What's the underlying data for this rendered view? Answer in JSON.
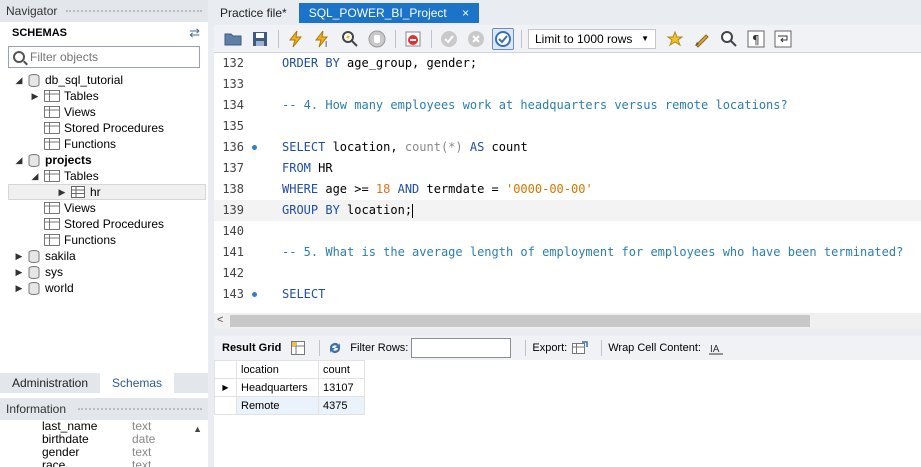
{
  "navigator": {
    "title": "Navigator",
    "schemas_label": "SCHEMAS",
    "filter_placeholder": "Filter objects",
    "tree": [
      {
        "label": "db_sql_tutorial",
        "kind": "schema",
        "expanded": true,
        "bold": false
      },
      {
        "label": "Tables",
        "kind": "folder",
        "expanded": false
      },
      {
        "label": "Views",
        "kind": "folder"
      },
      {
        "label": "Stored Procedures",
        "kind": "folder"
      },
      {
        "label": "Functions",
        "kind": "folder"
      },
      {
        "label": "projects",
        "kind": "schema",
        "expanded": true,
        "bold": true
      },
      {
        "label": "Tables",
        "kind": "folder",
        "expanded": true
      },
      {
        "label": "hr",
        "kind": "table",
        "selected": true
      },
      {
        "label": "Views",
        "kind": "folder"
      },
      {
        "label": "Stored Procedures",
        "kind": "folder"
      },
      {
        "label": "Functions",
        "kind": "folder"
      },
      {
        "label": "sakila",
        "kind": "schema"
      },
      {
        "label": "sys",
        "kind": "schema"
      },
      {
        "label": "world",
        "kind": "schema"
      }
    ],
    "bottom_tabs": [
      "Administration",
      "Schemas"
    ],
    "info_title": "Information",
    "info_columns": [
      {
        "name": "last_name",
        "type": "text"
      },
      {
        "name": "birthdate",
        "type": "date"
      },
      {
        "name": "gender",
        "type": "text"
      },
      {
        "name": "race",
        "type": "text"
      }
    ]
  },
  "tabs": [
    {
      "label": "Practice file*",
      "active": false
    },
    {
      "label": "SQL_POWER_BI_Project",
      "active": true,
      "close": "×"
    }
  ],
  "toolbar": {
    "limit_label": "Limit to 1000 rows",
    "dropdown_arrow": "▼"
  },
  "editor": {
    "lines": [
      {
        "n": "132",
        "marker": false
      },
      {
        "n": "133",
        "marker": false
      },
      {
        "n": "134",
        "marker": false
      },
      {
        "n": "135",
        "marker": false
      },
      {
        "n": "136",
        "marker": true
      },
      {
        "n": "137",
        "marker": false
      },
      {
        "n": "138",
        "marker": false
      },
      {
        "n": "139",
        "marker": false,
        "current": true
      },
      {
        "n": "140",
        "marker": false
      },
      {
        "n": "141",
        "marker": false
      },
      {
        "n": "142",
        "marker": false
      },
      {
        "n": "143",
        "marker": true
      }
    ],
    "tokens": {
      "l132_kw": "ORDER BY",
      "l132_rest": " age_group, gender;",
      "l134": "-- 4. How many employees work at headquarters versus remote locations?",
      "l136_kw1": "SELECT",
      "l136_a": " location, ",
      "l136_fn": "count(*)",
      "l136_kw2": " AS",
      "l136_b": " count",
      "l137_kw": "FROM",
      "l137_rest": " HR",
      "l138_kw1": "WHERE",
      "l138_a": " age >= ",
      "l138_num": "18",
      "l138_kw2": " AND",
      "l138_b": " termdate = ",
      "l138_str": "'0000-00-00'",
      "l139_kw": "GROUP BY",
      "l139_rest": " location;",
      "l141": "-- 5. What is the average length of employment for employees who have been terminated?",
      "l143_kw": "SELECT"
    }
  },
  "result_bar": {
    "result_grid": "Result Grid",
    "filter_rows": "Filter Rows:",
    "export": "Export:",
    "wrap": "Wrap Cell Content:"
  },
  "grid": {
    "headers": [
      "location",
      "count"
    ],
    "rows": [
      [
        "Headquarters",
        "13107"
      ],
      [
        "Remote",
        "4375"
      ]
    ]
  },
  "colors": {
    "accent": "#1c74c8",
    "keyword": "#1f4ea8",
    "comment": "#2b7fb0",
    "string": "#d47600"
  }
}
